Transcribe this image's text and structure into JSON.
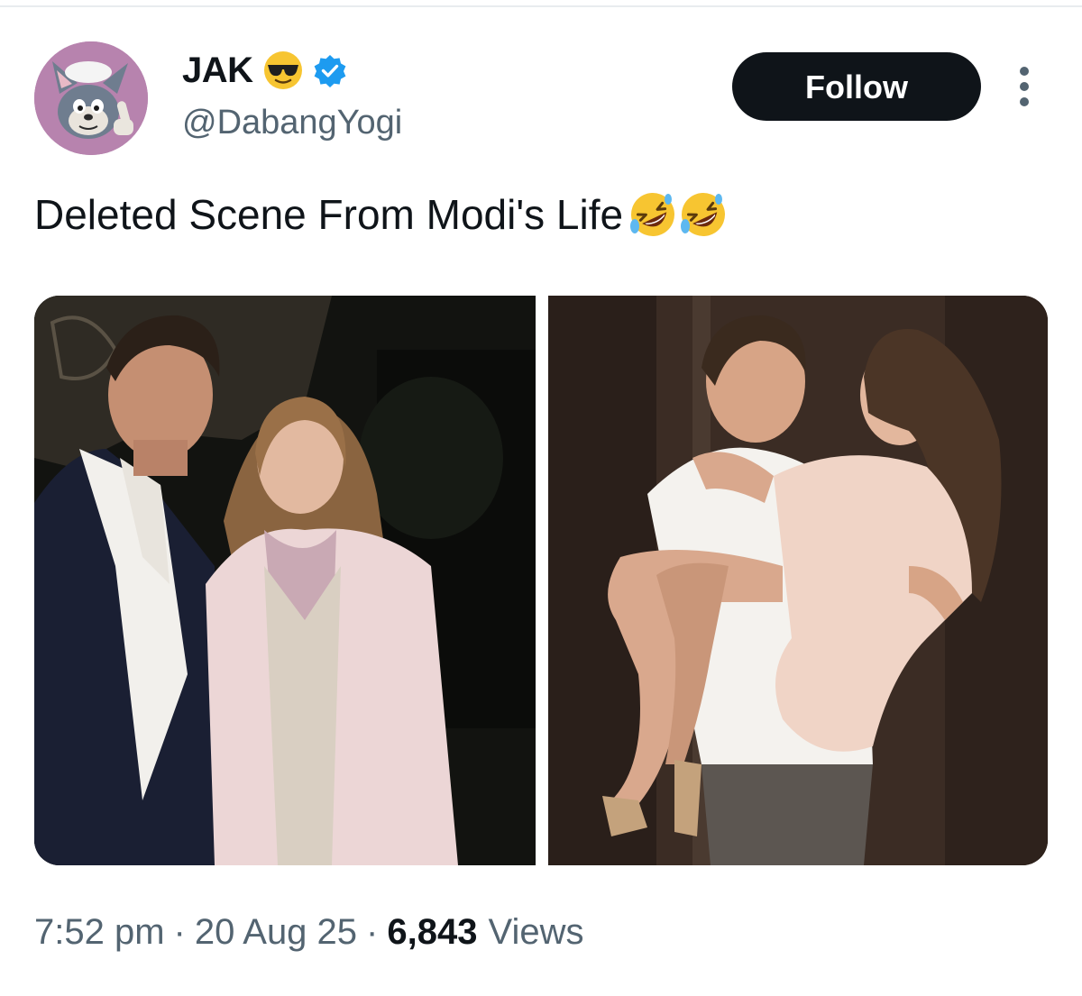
{
  "author": {
    "display_name": "JAK",
    "name_emoji": "smiling-face-with-sunglasses",
    "verified": true,
    "handle": "@DabangYogi"
  },
  "actions": {
    "follow_label": "Follow",
    "more_icon": "more-vertical-icon"
  },
  "tweet": {
    "text": "Deleted Scene From Modi's Life",
    "text_emojis": [
      "rolling-on-the-floor-laughing",
      "rolling-on-the-floor-laughing"
    ]
  },
  "media": {
    "count": 2
  },
  "meta": {
    "time": "7:52 pm",
    "separator": "·",
    "date": "20 Aug 25",
    "views_count": "6,843",
    "views_label": "Views"
  },
  "colors": {
    "text_primary": "#0f1419",
    "text_secondary": "#536471",
    "verified_blue": "#1d9bf0",
    "button_dark": "#0f1419"
  }
}
